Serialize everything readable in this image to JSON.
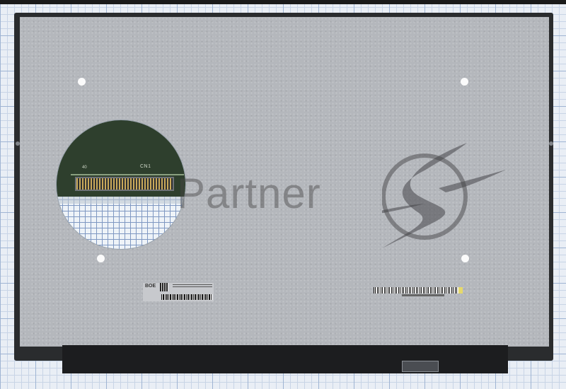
{
  "watermark": {
    "text": "Partner"
  },
  "connector_zoom": {
    "label": "CN1",
    "pin": "40"
  },
  "label_left": {
    "brand": "BOE"
  },
  "colors": {
    "panel": "#b4b7bc",
    "frame": "#2a2c2e",
    "grid": "#9fb4d3"
  }
}
